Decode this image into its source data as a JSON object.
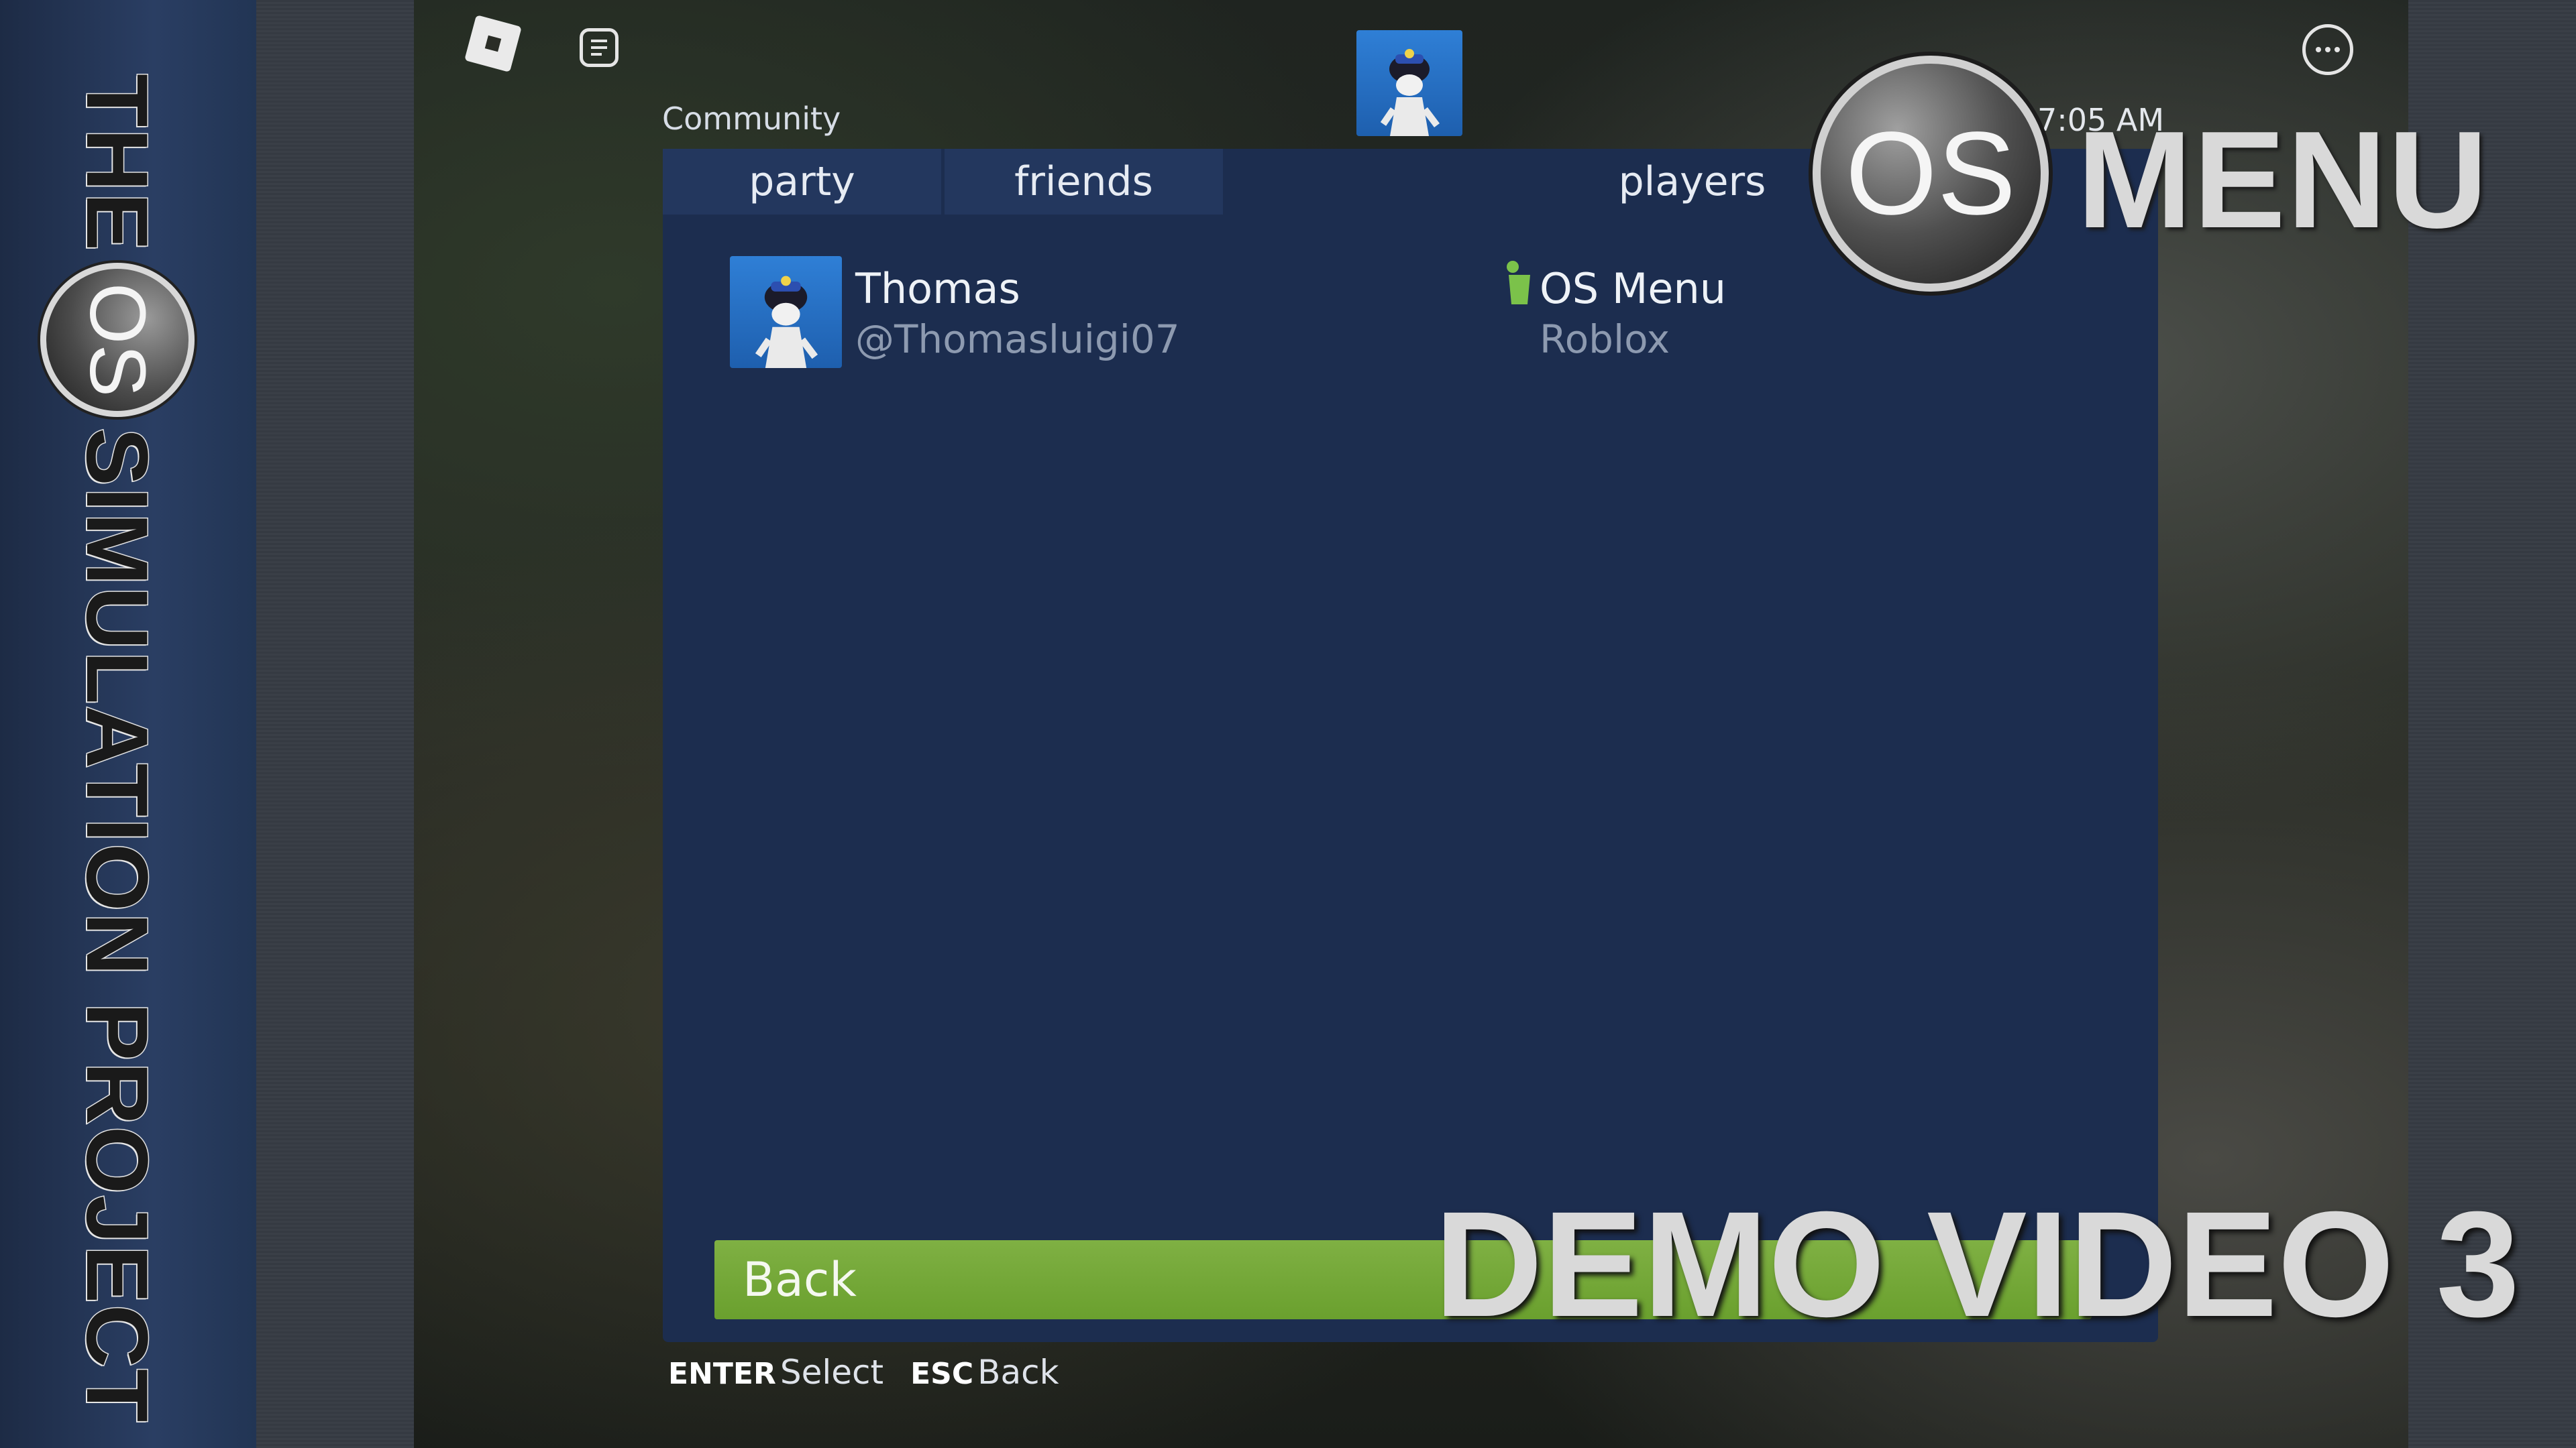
{
  "banner": {
    "prefix": "THE",
    "badge": "OS",
    "suffix": "SIMULATION PROJECT"
  },
  "topbar": {
    "community_label": "Community",
    "clock": "7:05 AM"
  },
  "tabs": [
    {
      "label": "party"
    },
    {
      "label": "friends"
    },
    {
      "label": "players"
    }
  ],
  "players": [
    {
      "display_name": "Thomas",
      "username": "@Thomasluigi07",
      "presence_game": "OS Menu",
      "presence_platform": "Roblox"
    }
  ],
  "back_bar": {
    "label": "Back"
  },
  "hints": [
    {
      "key": "ENTER",
      "action": "Select"
    },
    {
      "key": "ESC",
      "action": "Back"
    }
  ],
  "overlay": {
    "badge": "OS",
    "menu_title": "MENU",
    "demo_title": "DEMO VIDEO 3"
  },
  "colors": {
    "panel": "#1c2d4f",
    "back_bar": "#6aa02e",
    "banner": "#223554"
  }
}
